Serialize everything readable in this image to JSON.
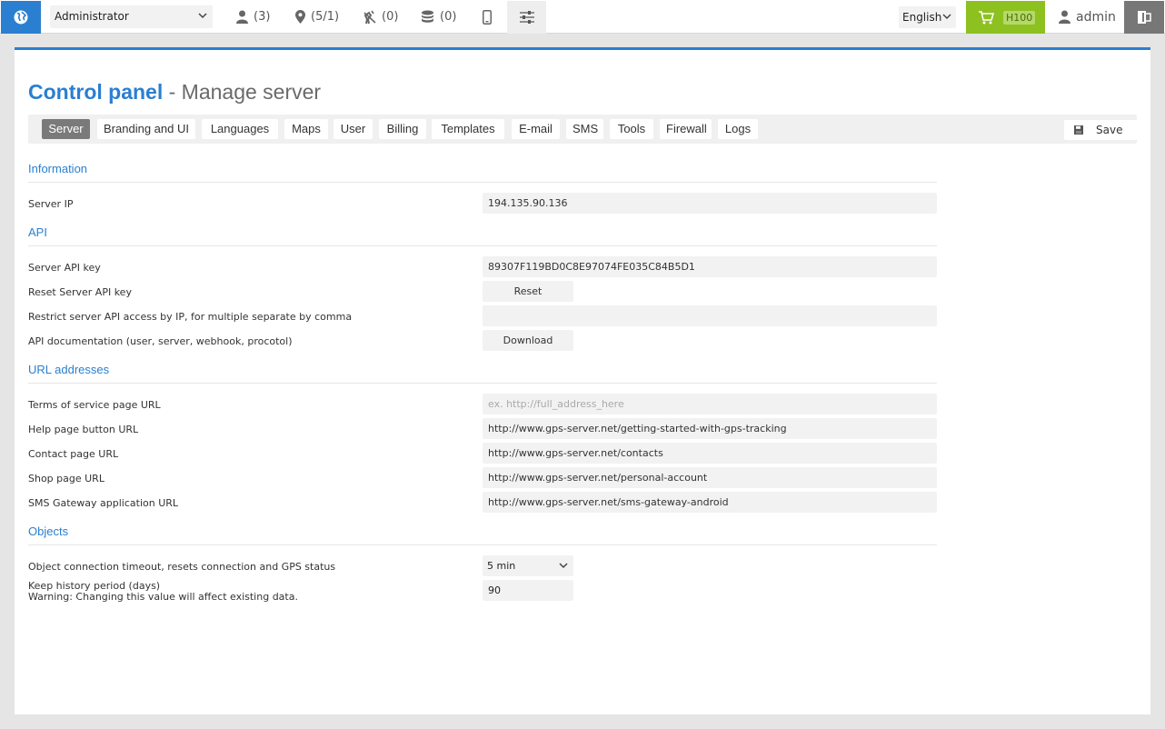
{
  "topbar": {
    "role": "Administrator",
    "users_count": "(3)",
    "objects_count": "(5/1)",
    "unused_count": "(0)",
    "billing_count": "(0)",
    "language": "English",
    "cart_badge": "H100",
    "username": "admin"
  },
  "header": {
    "title": "Control panel",
    "subtitle": "- Manage server"
  },
  "tabs": [
    "Server",
    "Branding and UI",
    "Languages",
    "Maps",
    "User",
    "Billing",
    "Templates",
    "E-mail",
    "SMS",
    "Tools",
    "Firewall",
    "Logs"
  ],
  "save_label": "Save",
  "sections": {
    "information": "Information",
    "api": "API",
    "urls": "URL addresses",
    "objects": "Objects"
  },
  "server_ip": {
    "label": "Server IP",
    "value": "194.135.90.136"
  },
  "api_key": {
    "label": "Server API key",
    "value": "89307F119BD0C8E97074FE035C84B5D1"
  },
  "reset_key": {
    "label": "Reset Server API key",
    "button": "Reset"
  },
  "restrict_ip": {
    "label": "Restrict server API access by IP, for multiple separate by comma",
    "value": ""
  },
  "api_docs": {
    "label": "API documentation (user, server, webhook, procotol)",
    "button": "Download"
  },
  "tos_url": {
    "label": "Terms of service page URL",
    "placeholder": "ex. http://full_address_here"
  },
  "help_url": {
    "label": "Help page button URL",
    "value": "http://www.gps-server.net/getting-started-with-gps-tracking"
  },
  "contact_url": {
    "label": "Contact page URL",
    "value": "http://www.gps-server.net/contacts"
  },
  "shop_url": {
    "label": "Shop page URL",
    "value": "http://www.gps-server.net/personal-account"
  },
  "sms_url": {
    "label": "SMS Gateway application URL",
    "value": "http://www.gps-server.net/sms-gateway-android"
  },
  "conn_timeout": {
    "label": "Object connection timeout, resets connection and GPS status",
    "value": "5 min"
  },
  "history": {
    "label": "Keep history period (days)",
    "warning": "Warning: Changing this value will affect existing data.",
    "value": "90"
  },
  "colors": {
    "accent": "#2a7fd0",
    "cart": "#8cc11f",
    "logout": "#777777"
  }
}
